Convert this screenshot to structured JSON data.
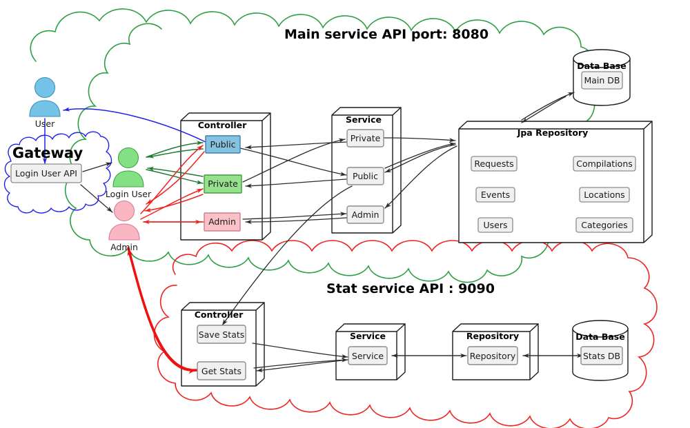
{
  "diagram": {
    "title_main": "Main service API port: 8080",
    "title_stat": "Stat service API : 9090",
    "gateway": {
      "title": "Gateway",
      "api_label": "Login User API",
      "cloud_color": "#2020ee"
    },
    "actors": [
      {
        "name": "User",
        "label": "User",
        "color": "#76c3e8"
      },
      {
        "name": "Login User",
        "label": "Login User",
        "color": "#84e084"
      },
      {
        "name": "Admin",
        "label": "Admin",
        "color": "#fab6c3"
      }
    ],
    "main_service": {
      "cloud_color": "#2e9e43",
      "controller": {
        "title": "Controller",
        "items": [
          {
            "label": "Public",
            "color": "#85c2e0"
          },
          {
            "label": "Private",
            "color": "#97e08d"
          },
          {
            "label": "Admin",
            "color": "#fac1c9"
          }
        ]
      },
      "service": {
        "title": "Service",
        "items": [
          {
            "label": "Private",
            "color": "#f0f0f0"
          },
          {
            "label": "Public",
            "color": "#f0f0f0"
          },
          {
            "label": "Admin",
            "color": "#f0f0f0"
          }
        ]
      },
      "repository": {
        "title": "Jpa Repository",
        "items_left": [
          "Requests",
          "Events",
          "Users"
        ],
        "items_right": [
          "Compilations",
          "Locations",
          "Categories"
        ]
      },
      "database": {
        "title": "Data Base",
        "item": "Main DB"
      }
    },
    "stat_service": {
      "cloud_color": "#ee2222",
      "controller": {
        "title": "Controller",
        "items": [
          {
            "label": "Save Stats"
          },
          {
            "label": "Get Stats"
          }
        ]
      },
      "service": {
        "title": "Service",
        "item": "Service"
      },
      "repository": {
        "title": "Repository",
        "item": "Repository"
      },
      "database": {
        "title": "Data Base",
        "item": "Stats DB"
      }
    },
    "colors": {
      "green": "#2e9e43",
      "red": "#ee2222",
      "blue": "#2020ee",
      "arrow_dark": "#2b2b2b",
      "box_fill": "#f0f0f0",
      "box_stroke": "#8c8c8c"
    }
  }
}
